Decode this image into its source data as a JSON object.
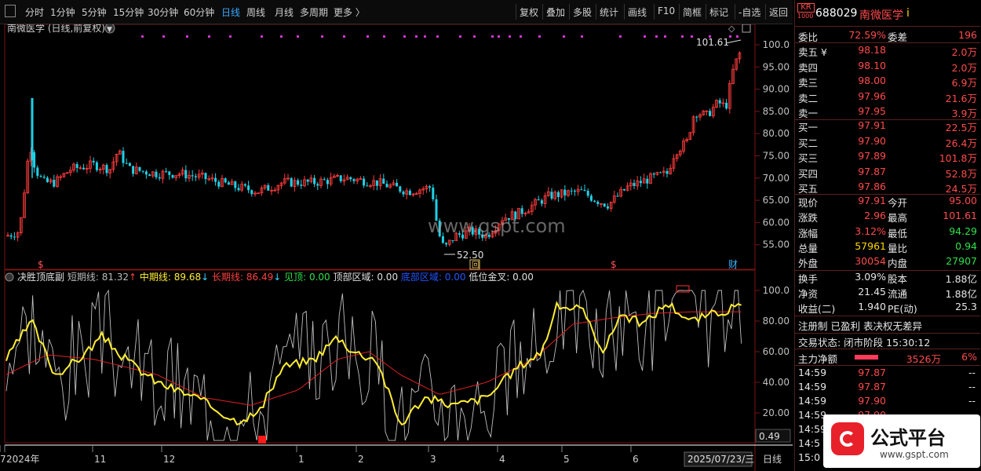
{
  "toolbar": {
    "left_icon": "panel-toggle-icon",
    "periods": [
      "分时",
      "1分钟",
      "5分钟",
      "15分钟",
      "30分钟",
      "60分钟",
      "日线",
      "周线",
      "月线",
      "多周期",
      "更多 〉"
    ],
    "active_period": "日线",
    "actions": [
      "复权",
      "叠加",
      "多股",
      "统计",
      "画线",
      "F10",
      "简框",
      "标记",
      "-自选",
      "返回"
    ]
  },
  "main_chart": {
    "title": "南微医学 (日线,前复权)",
    "y_ticks": [
      "100.0",
      "95.00",
      "90.00",
      "85.00",
      "80.00",
      "75.00",
      "70.00",
      "65.00",
      "60.00",
      "55.00"
    ],
    "high_label": "101.61",
    "low_label": "52.50",
    "watermark": "www.gspt.com",
    "markers": [
      "$",
      "$",
      "财",
      "回"
    ]
  },
  "indicator": {
    "name": "决胜顶底副",
    "short_label": "短期线:",
    "short_value": "81.32",
    "mid_label": "中期线:",
    "mid_value": "89.68",
    "long_label": "长期线:",
    "long_value": "86.49",
    "top_label": "见顶:",
    "top_value": "0.00",
    "top_zone_label": "顶部区域:",
    "top_zone_value": "0.00",
    "bottom_zone_label": "底部区域:",
    "bottom_zone_value": "0.00",
    "cross_label": "低位金叉:",
    "cross_value": "0.00",
    "y_ticks": [
      "100.0",
      "80.00",
      "60.00",
      "40.00",
      "20.00"
    ],
    "current": "0.49"
  },
  "x_axis": {
    "labels": [
      "2024年",
      "11",
      "12",
      "1",
      "2",
      "3",
      "4",
      "5",
      "6",
      "7"
    ],
    "date_box": "2025/07/23/三",
    "period_button": "日线"
  },
  "quote": {
    "badge_top": "KR",
    "badge_bottom": "1000",
    "code": "688029",
    "name": "南微医学",
    "info_mark": "i",
    "wei_bi_label": "委比",
    "wei_bi": "72.59%",
    "wei_cha_label": "委差",
    "wei_cha": "196",
    "asks": [
      {
        "label": "卖五 ¥",
        "price": "98.18",
        "vol": "2.0万"
      },
      {
        "label": "卖四",
        "price": "98.10",
        "vol": "2.0万"
      },
      {
        "label": "卖三",
        "price": "98.00",
        "vol": "6.9万"
      },
      {
        "label": "卖二",
        "price": "97.96",
        "vol": "21.6万"
      },
      {
        "label": "卖一",
        "price": "97.95",
        "vol": "3.9万"
      }
    ],
    "bids": [
      {
        "label": "买一",
        "price": "97.91",
        "vol": "22.5万"
      },
      {
        "label": "买二",
        "price": "97.90",
        "vol": "26.4万"
      },
      {
        "label": "买三",
        "price": "97.89",
        "vol": "101.8万"
      },
      {
        "label": "买四",
        "price": "97.87",
        "vol": "52.8万"
      },
      {
        "label": "买五",
        "price": "97.86",
        "vol": "24.5万"
      }
    ],
    "stats": [
      {
        "l1": "现价",
        "v1": "97.91",
        "c1": "red",
        "l2": "今开",
        "v2": "95.00",
        "c2": "red"
      },
      {
        "l1": "涨跌",
        "v1": "2.96",
        "c1": "red",
        "l2": "最高",
        "v2": "101.61",
        "c2": "red"
      },
      {
        "l1": "涨幅",
        "v1": "3.12%",
        "c1": "red",
        "l2": "最低",
        "v2": "94.29",
        "c2": "green"
      },
      {
        "l1": "总量",
        "v1": "57961",
        "c1": "yellow",
        "l2": "量比",
        "v2": "0.94",
        "c2": "green"
      },
      {
        "l1": "外盘",
        "v1": "30054",
        "c1": "red",
        "l2": "内盘",
        "v2": "27907",
        "c2": "green"
      }
    ],
    "stats2": [
      {
        "l1": "换手",
        "v1": "3.09%",
        "l2": "股本",
        "v2": "1.88亿"
      },
      {
        "l1": "净资",
        "v1": "21.45",
        "l2": "流通",
        "v2": "1.88亿"
      },
      {
        "l1": "收益(二)",
        "v1": "1.940",
        "l2": "PE(动)",
        "v2": "25.3"
      }
    ],
    "reg_text": "注册制 已盈利 表决权无差异",
    "trade_status": "交易状态: 闭市阶段 15:30:12",
    "main_flow_label": "主力净额",
    "main_flow_value": "3526万",
    "main_flow_pct": "6%",
    "ticks": [
      {
        "t": "14:59",
        "p": "97.87",
        "v": "--"
      },
      {
        "t": "14:59",
        "p": "97.87",
        "v": "--"
      },
      {
        "t": "14:59",
        "p": "97.90",
        "v": "--"
      },
      {
        "t": "14:59",
        "p": "97.90",
        "v": "--"
      },
      {
        "t": "14:59",
        "p": "",
        "v": "--"
      },
      {
        "t": "14:5",
        "p": "",
        "v": ""
      },
      {
        "t": "15:0",
        "p": "",
        "v": ""
      }
    ],
    "logo_text": "公式平台",
    "logo_url": "www.gspt.com"
  },
  "colors": {
    "up": "#ff3c3c",
    "down": "#1fd1e6",
    "mid_line": "#ffee33",
    "long_line": "#e02020",
    "short_line": "#bfbfbf"
  }
}
